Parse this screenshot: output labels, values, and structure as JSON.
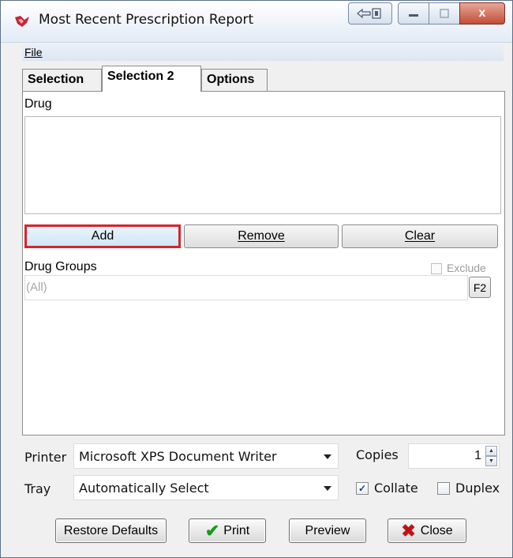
{
  "window": {
    "title": "Most Recent Prescription Report",
    "close_glyph": "x"
  },
  "menu": {
    "file_label": "File"
  },
  "tabs": [
    {
      "label": "Selection",
      "active": false
    },
    {
      "label": "Selection 2",
      "active": true
    },
    {
      "label": "Options",
      "active": false
    }
  ],
  "drug_section": {
    "label": "Drug",
    "add_label": "Add",
    "remove_label": "Remove",
    "clear_label": "Clear"
  },
  "drug_groups": {
    "label": "Drug Groups",
    "exclude_label": "Exclude",
    "exclude_checked": false,
    "value": "(All)",
    "lookup_label": "F2"
  },
  "print_settings": {
    "printer_label": "Printer",
    "printer_value": "Microsoft XPS Document Writer",
    "copies_label": "Copies",
    "copies_value": "1",
    "tray_label": "Tray",
    "tray_value": "Automatically Select",
    "collate_label": "Collate",
    "collate_checked": true,
    "duplex_label": "Duplex",
    "duplex_checked": false
  },
  "footer": {
    "restore_label": "Restore Defaults",
    "print_label": "Print",
    "preview_label": "Preview",
    "close_label": "Close"
  },
  "colors": {
    "highlight_border": "#d8232a",
    "print_check": "#1a9a1a",
    "close_x": "#c01414"
  }
}
